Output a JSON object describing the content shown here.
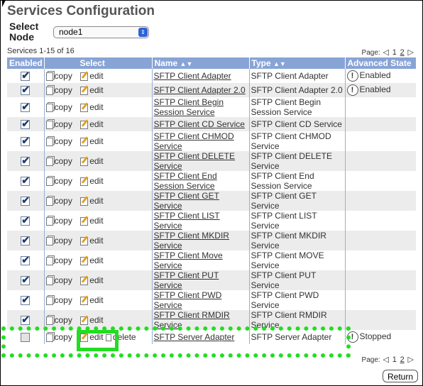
{
  "page": {
    "title": "Services Configuration",
    "node_label": "Select Node",
    "node_value": "node1",
    "count_text": "Services 1-15 of 16",
    "pager": {
      "label": "Page:",
      "prev": "◁",
      "page1": "1",
      "page2": "2",
      "next": "▷"
    },
    "return_label": "Return"
  },
  "table": {
    "headers": {
      "enabled": "Enabled",
      "select": "Select",
      "name": "Name",
      "type": "Type",
      "state": "Advanced State",
      "sort": "▲▼"
    },
    "copy_label": "copy",
    "edit_label": "edit",
    "delete_label": "delete",
    "rows": [
      {
        "enabled": true,
        "name": "SFTP Client Adapter",
        "type": "SFTP Client Adapter",
        "state": "Enabled"
      },
      {
        "enabled": true,
        "name": "SFTP Client Adapter 2.0",
        "type": "SFTP Client Adapter 2.0",
        "state": "Enabled"
      },
      {
        "enabled": true,
        "name": "SFTP Client Begin Session Service",
        "type": "SFTP Client Begin Session Service",
        "state": ""
      },
      {
        "enabled": true,
        "name": "SFTP Client CD Service",
        "type": "SFTP Client CD Service",
        "state": ""
      },
      {
        "enabled": true,
        "name": "SFTP Client CHMOD Service",
        "type": "SFTP Client CHMOD Service",
        "state": ""
      },
      {
        "enabled": true,
        "name": "SFTP Client DELETE Service",
        "type": "SFTP Client DELETE Service",
        "state": ""
      },
      {
        "enabled": true,
        "name": "SFTP Client End Session Service",
        "type": "SFTP Client End Session Service",
        "state": ""
      },
      {
        "enabled": true,
        "name": "SFTP Client GET Service",
        "type": "SFTP Client GET Service",
        "state": ""
      },
      {
        "enabled": true,
        "name": "SFTP Client LIST Service",
        "type": "SFTP Client LIST Service",
        "state": ""
      },
      {
        "enabled": true,
        "name": "SFTP Client MKDIR Service",
        "type": "SFTP Client MKDIR Service",
        "state": ""
      },
      {
        "enabled": true,
        "name": "SFTP Client Move Service",
        "type": "SFTP Client MOVE Service",
        "state": ""
      },
      {
        "enabled": true,
        "name": "SFTP Client PUT Service",
        "type": "SFTP Client PUT Service",
        "state": ""
      },
      {
        "enabled": true,
        "name": "SFTP Client PWD Service",
        "type": "SFTP Client PWD Service",
        "state": ""
      },
      {
        "enabled": true,
        "name": "SFTP Client RMDIR Service",
        "type": "SFTP Client RMDIR Service",
        "state": ""
      },
      {
        "enabled": false,
        "name": "SFTP Server Adapter",
        "type": "SFTP Server Adapter",
        "state": "Stopped",
        "deletable": true
      }
    ]
  },
  "icons": {
    "copy": "copy-icon",
    "edit": "edit-icon",
    "delete": "trash-icon",
    "state": "info-circle-icon",
    "select_arrow": "select-arrows-icon"
  },
  "colors": {
    "header_bg": "#88a4d6",
    "highlight": "#22dd22",
    "check": "#1e3c72"
  }
}
